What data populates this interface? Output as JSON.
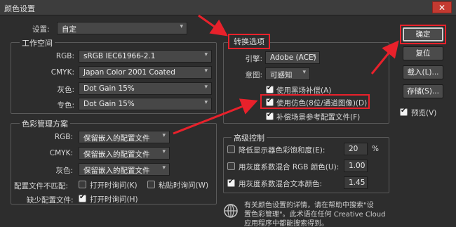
{
  "window": {
    "title": "颜色设置",
    "close_glyph": "✕"
  },
  "settings": {
    "label": "设置:",
    "value": "自定"
  },
  "working_space": {
    "title": "工作空间",
    "rows": [
      {
        "label": "RGB:",
        "value": "sRGB IEC61966-2.1"
      },
      {
        "label": "CMYK:",
        "value": "Japan Color 2001 Coated"
      },
      {
        "label": "灰色:",
        "value": "Dot Gain 15%"
      },
      {
        "label": "专色:",
        "value": "Dot Gain 15%"
      }
    ]
  },
  "color_mgmt": {
    "title": "色彩管理方案",
    "rows": [
      {
        "label": "RGB:",
        "value": "保留嵌入的配置文件"
      },
      {
        "label": "CMYK:",
        "value": "保留嵌入的配置文件"
      },
      {
        "label": "灰色:",
        "value": "保留嵌入的配置文件"
      }
    ],
    "mismatch_label": "配置文件不匹配:",
    "mismatch_open": "打开时询问(K)",
    "mismatch_paste": "粘贴时询问(W)",
    "missing_label": "缺少配置文件:",
    "missing_open": "打开时询问(H)"
  },
  "conversion": {
    "title": "转换选项",
    "engine_label": "引擎:",
    "engine_value": "Adobe (ACE)",
    "intent_label": "意图:",
    "intent_value": "可感知",
    "black_point": "使用黑场补偿(A)",
    "dither": "使用仿色(8位/通道图像)(D)",
    "scene_ref": "补偿场景参考配置文件(F)"
  },
  "advanced": {
    "title": "高级控制",
    "desaturate_label": "降低显示器色彩饱和度(E):",
    "desaturate_value": "20",
    "desaturate_unit": "%",
    "blend_rgb_label": "用灰度系数混合 RGB 颜色(U):",
    "blend_rgb_value": "1.00",
    "blend_text_label": "用灰度系数混合文本颜色:",
    "blend_text_value": "1.45"
  },
  "info": {
    "line1": "有关颜色设置的详情，请在帮助中搜索\"设",
    "line2": "置色彩管理\"。此术语在任何 Creative Cloud",
    "line3": "应用程序中都能搜索得到。"
  },
  "buttons": {
    "ok": "确定",
    "reset": "复位",
    "load": "载入(L)...",
    "save": "存储(S)...",
    "preview": "预览(V)"
  },
  "icons": {
    "dropdown": "▾",
    "check": "✔",
    "info": "info-globe-icon"
  },
  "colors": {
    "annotation_red": "#e8212b",
    "dialog_bg": "#2d2d2d",
    "field_bg": "#474747"
  }
}
